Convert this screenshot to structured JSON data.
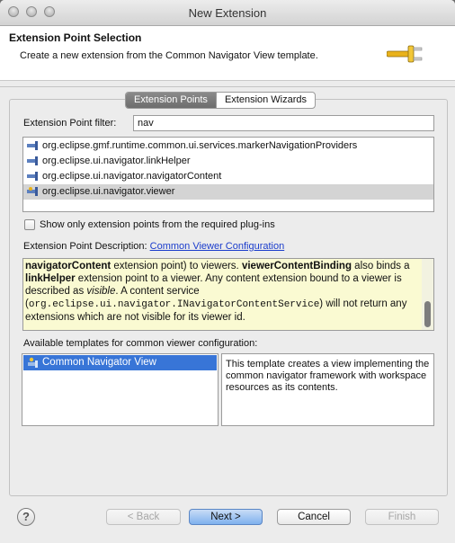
{
  "window": {
    "title": "New Extension"
  },
  "banner": {
    "title": "Extension Point Selection",
    "description": "Create a new extension from the Common Navigator View template."
  },
  "tabs": [
    {
      "label": "Extension Points",
      "active": true
    },
    {
      "label": "Extension Wizards",
      "active": false
    }
  ],
  "filter": {
    "label": "Extension Point filter:",
    "value": "nav"
  },
  "extension_points": [
    {
      "label": "org.eclipse.gmf.runtime.common.ui.services.markerNavigationProviders",
      "icon": "extension-point-icon",
      "selected": false
    },
    {
      "label": "org.eclipse.ui.navigator.linkHelper",
      "icon": "extension-point-icon",
      "selected": false
    },
    {
      "label": "org.eclipse.ui.navigator.navigatorContent",
      "icon": "extension-point-icon",
      "selected": false
    },
    {
      "label": "org.eclipse.ui.navigator.viewer",
      "icon": "extension-point-template-icon",
      "selected": true
    }
  ],
  "required_only": {
    "label": "Show only extension points from the required plug-ins",
    "checked": false
  },
  "description": {
    "label": "Extension Point Description:",
    "link": "Common Viewer Configuration",
    "text": {
      "t1": "navigatorContent",
      "t2": " extension point) to viewers. ",
      "t3": "viewerContentBinding",
      "t4": " also binds a ",
      "t5": "linkHelper",
      "t6": " extension point to a viewer. Any content extension bound to a viewer is described as ",
      "t7": "visible",
      "t8": ". A content service (",
      "t9": "org.eclipse.ui.navigator.INavigatorContentService",
      "t10": ") will not return any extensions which are not visible for its viewer id."
    }
  },
  "templates": {
    "label": "Available templates for common viewer configuration:",
    "items": [
      {
        "label": "Common Navigator View",
        "icon": "template-icon",
        "selected": true
      }
    ],
    "description": "This template creates a view implementing the common navigator framework with workspace resources as its contents."
  },
  "buttons": {
    "help": "?",
    "back": "< Back",
    "next": "Next >",
    "cancel": "Cancel",
    "finish": "Finish"
  },
  "colors": {
    "selection": "#3875d7",
    "description_bg": "#fafad2",
    "link": "#1a3ccc"
  }
}
